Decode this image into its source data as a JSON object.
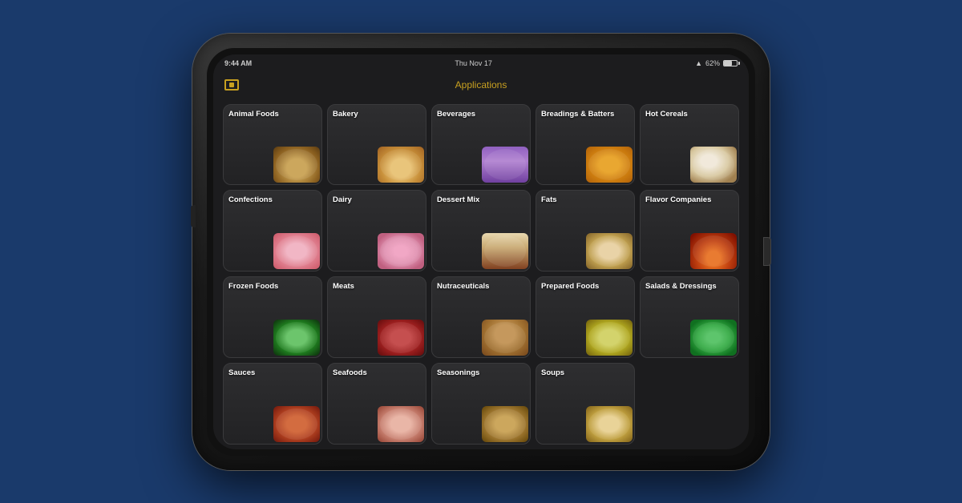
{
  "app": {
    "title": "Applications",
    "status": {
      "time": "9:44 AM",
      "date": "Thu Nov 17",
      "battery": "62%"
    }
  },
  "grid": {
    "items": [
      {
        "id": "animal-foods",
        "label": "Animal Foods",
        "img_class": "img-animal-foods"
      },
      {
        "id": "bakery",
        "label": "Bakery",
        "img_class": "img-bakery"
      },
      {
        "id": "beverages",
        "label": "Beverages",
        "img_class": "img-beverages"
      },
      {
        "id": "breadings-batters",
        "label": "Breadings & Batters",
        "img_class": "img-breadings"
      },
      {
        "id": "hot-cereals",
        "label": "Hot Cereals",
        "img_class": "img-hot-cereals"
      },
      {
        "id": "confections",
        "label": "Confections",
        "img_class": "img-confections"
      },
      {
        "id": "dairy",
        "label": "Dairy",
        "img_class": "img-dairy"
      },
      {
        "id": "dessert-mix",
        "label": "Dessert Mix",
        "img_class": "img-dessert-mix"
      },
      {
        "id": "fats",
        "label": "Fats",
        "img_class": "img-fats"
      },
      {
        "id": "flavor-companies",
        "label": "Flavor Companies",
        "img_class": "img-flavor"
      },
      {
        "id": "frozen-foods",
        "label": "Frozen Foods",
        "img_class": "img-frozen"
      },
      {
        "id": "meats",
        "label": "Meats",
        "img_class": "img-meats"
      },
      {
        "id": "nutraceuticals",
        "label": "Nutraceuticals",
        "img_class": "img-nutraceuticals"
      },
      {
        "id": "prepared-foods",
        "label": "Prepared Foods",
        "img_class": "img-prepared"
      },
      {
        "id": "salads-dressings",
        "label": "Salads & Dressings",
        "img_class": "img-salads"
      },
      {
        "id": "sauces",
        "label": "Sauces",
        "img_class": "img-sauces"
      },
      {
        "id": "seafoods",
        "label": "Seafoods",
        "img_class": "img-seafoods"
      },
      {
        "id": "seasonings",
        "label": "Seasonings",
        "img_class": "img-seasonings"
      },
      {
        "id": "soups",
        "label": "Soups",
        "img_class": "img-soups"
      }
    ]
  }
}
